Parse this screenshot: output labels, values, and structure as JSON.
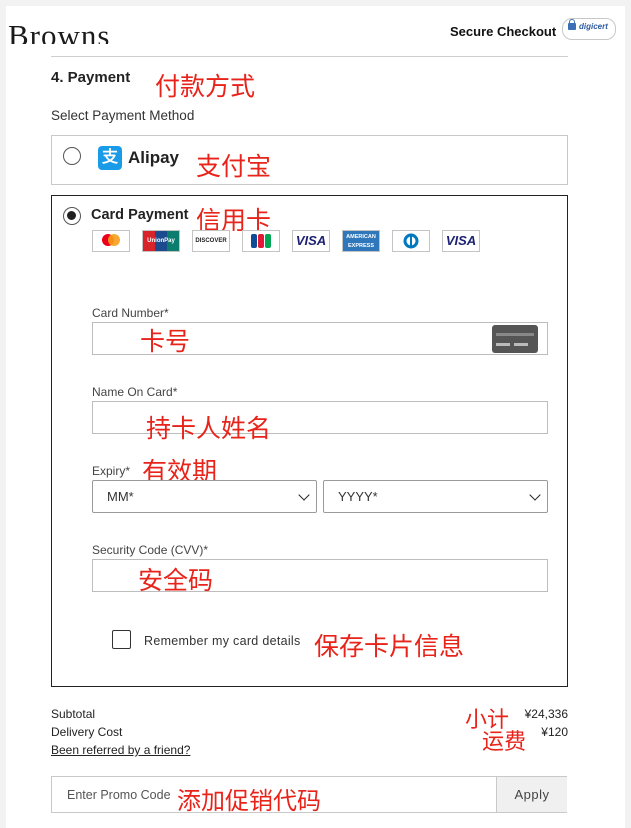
{
  "header": {
    "logo": "Browns",
    "secure_checkout": "Secure Checkout",
    "badge_text": "digicert"
  },
  "payment": {
    "section_title": "4. Payment",
    "section_note": "付款方式",
    "select_label": "Select Payment Method",
    "options": [
      {
        "label": "Alipay",
        "note": "支付宝",
        "selected": false
      },
      {
        "label": "Card Payment",
        "note": "信用卡",
        "selected": true
      }
    ],
    "card_brands": [
      "mastercard",
      "UnionPay",
      "DISCOVER",
      "JCB",
      "VISA",
      "AMERICAN EXPRESS",
      "Diners",
      "VISA"
    ]
  },
  "form": {
    "card_number": {
      "label": "Card Number*",
      "note": "卡号",
      "value": ""
    },
    "name_on_card": {
      "label": "Name On Card*",
      "note": "持卡人姓名",
      "value": ""
    },
    "expiry": {
      "label": "Expiry*",
      "note": "有效期",
      "month_selected": "MM*",
      "year_selected": "YYYY*"
    },
    "security_code": {
      "label": "Security Code (CVV)*",
      "note": "安全码",
      "value": ""
    },
    "remember": {
      "label": "Remember my card details",
      "note": "保存卡片信息",
      "checked": false
    }
  },
  "summary": {
    "subtotal_label": "Subtotal",
    "subtotal_note": "小计",
    "subtotal_value": "¥24,336",
    "delivery_label": "Delivery Cost",
    "delivery_note": "运费",
    "delivery_value": "¥120",
    "referral_link": "Been referred by a friend?"
  },
  "promo": {
    "placeholder": "Enter Promo Code",
    "note": "添加促销代码",
    "apply_label": "Apply"
  },
  "colors": {
    "annotation": "#e8231a",
    "alipay_blue": "#1a9be8",
    "border_dark": "#222222"
  }
}
